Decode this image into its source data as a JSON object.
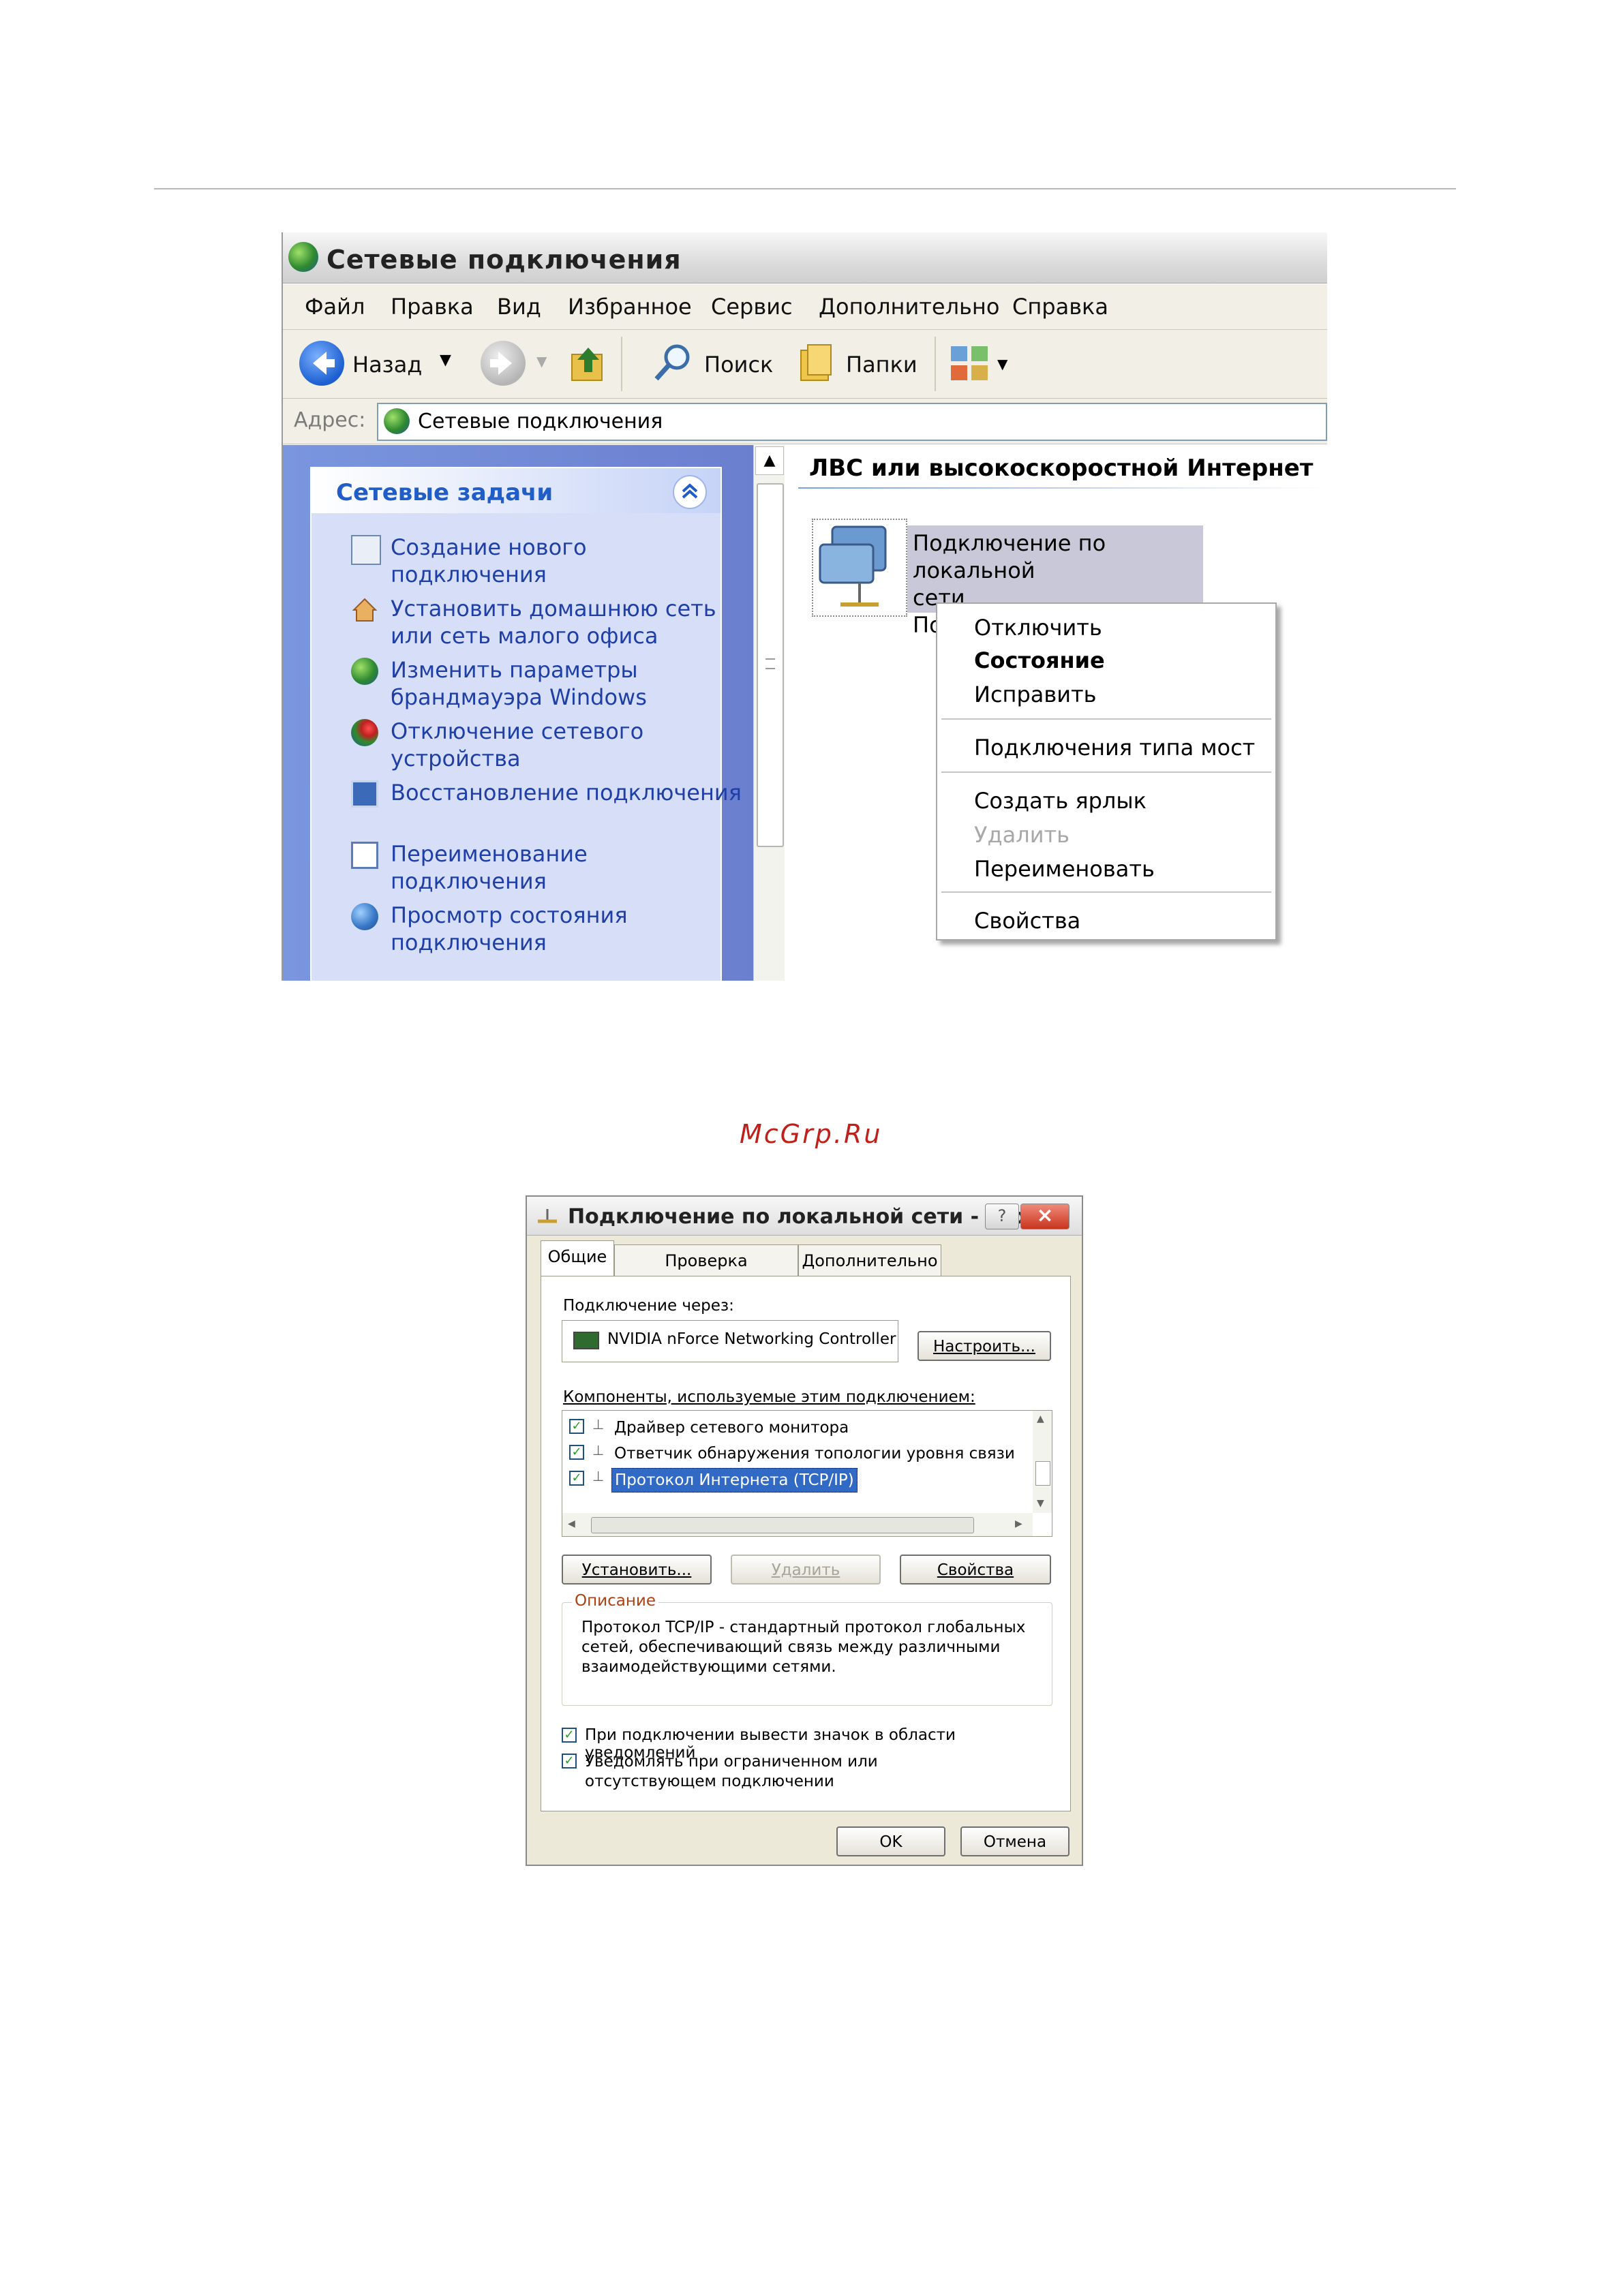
{
  "explorer": {
    "title": "Сетевые подключения",
    "menu": [
      "Файл",
      "Правка",
      "Вид",
      "Избранное",
      "Сервис",
      "Дополнительно",
      "Справка"
    ],
    "toolbar": {
      "back": "Назад",
      "search": "Поиск",
      "folders": "Папки"
    },
    "address": {
      "label": "Адрес:",
      "value": "Сетевые подключения"
    },
    "tasks": {
      "title": "Сетевые задачи",
      "items": [
        {
          "label": "Создание нового подключения",
          "icon": "new-connection-icon"
        },
        {
          "label": "Установить домашнюю сеть или сеть малого офиса",
          "icon": "home-network-icon"
        },
        {
          "label": "Изменить параметры брандмауэра Windows",
          "icon": "firewall-icon"
        },
        {
          "label": "Отключение сетевого устройства",
          "icon": "disable-device-icon"
        },
        {
          "label": "Восстановление подключения",
          "icon": "repair-icon"
        },
        {
          "label": "Переименование подключения",
          "icon": "rename-icon"
        },
        {
          "label": "Просмотр состояния подключения",
          "icon": "status-icon"
        }
      ]
    },
    "section_title": "ЛВС или высокоскоростной Интернет",
    "connection": {
      "name_line1": "Подключение по локальной",
      "name_line2": "сети",
      "name_line3": "По"
    },
    "context_menu": {
      "disconnect": "Отключить",
      "status": "Состояние",
      "repair": "Исправить",
      "bridge": "Подключения типа мост",
      "shortcut": "Создать ярлык",
      "delete": "Удалить",
      "rename": "Переименовать",
      "properties": "Свойства"
    }
  },
  "watermark": "McGrp.Ru",
  "dialog": {
    "title": "Подключение по локальной сети - сво...",
    "help_btn": "?",
    "close_btn": "×",
    "tabs": [
      "Общие",
      "Проверка подлинности",
      "Дополнительно"
    ],
    "connect_via_label": "Подключение через:",
    "adapter": "NVIDIA nForce Networking Controller",
    "configure_btn": "Настроить...",
    "components_label": "Компоненты, используемые этим подключением:",
    "components": [
      "Драйвер сетевого монитора",
      "Ответчик обнаружения топологии уровня связи",
      "Протокол Интернета (TCP/IP)"
    ],
    "install_btn": "Установить...",
    "remove_btn": "Удалить",
    "properties_btn": "Свойства",
    "description_legend": "Описание",
    "description_text": "Протокол TCP/IP - стандартный протокол глобальных сетей, обеспечивающий связь между различными взаимодействующими сетями.",
    "show_icon_chk": "При подключении вывести значок в области уведомлений",
    "notify_chk": "Уведомлять при ограниченном или отсутствующем подключении",
    "ok_btn": "OK",
    "cancel_btn": "Отмена"
  }
}
